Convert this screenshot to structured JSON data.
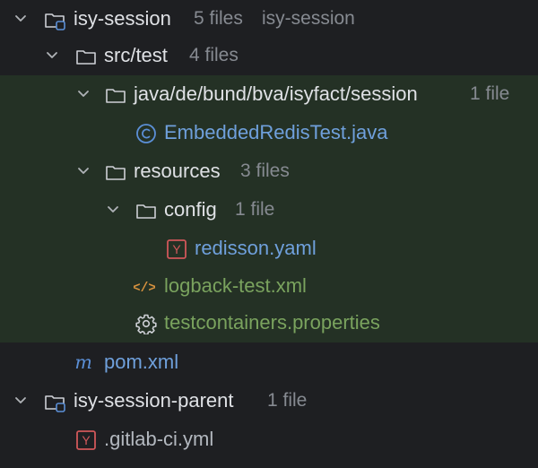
{
  "tree": {
    "isy_session": {
      "name": "isy-session",
      "count": "5 files",
      "extra": "isy-session"
    },
    "src_test": {
      "name": "src/test",
      "count": "4 files"
    },
    "java_pkg": {
      "name": "java/de/bund/bva/isyfact/session",
      "count": "1 file"
    },
    "embedded_test": {
      "name": "EmbeddedRedisTest.java",
      "icon": "java-class-icon"
    },
    "resources": {
      "name": "resources",
      "count": "3 files"
    },
    "config": {
      "name": "config",
      "count": "1 file"
    },
    "redisson": {
      "name": "redisson.yaml",
      "icon_letter": "Y"
    },
    "logback": {
      "name": "logback-test.xml",
      "icon_text": "</>"
    },
    "testcontainers": {
      "name": "testcontainers.properties",
      "icon": "gear-icon"
    },
    "pom": {
      "name": "pom.xml",
      "icon_letter": "m"
    },
    "parent": {
      "name": "isy-session-parent",
      "count": "1 file"
    },
    "gitlab": {
      "name": ".gitlab-ci.yml",
      "icon_letter": "Y"
    }
  },
  "colors": {
    "background": "#1e1f22",
    "highlight": "#243125",
    "text": "#dfe1e5",
    "hint": "#868a91",
    "blue": "#6fa0dc",
    "green": "#7aa35e",
    "yaml_red": "#d0575a",
    "xml_orange": "#d7923e"
  }
}
